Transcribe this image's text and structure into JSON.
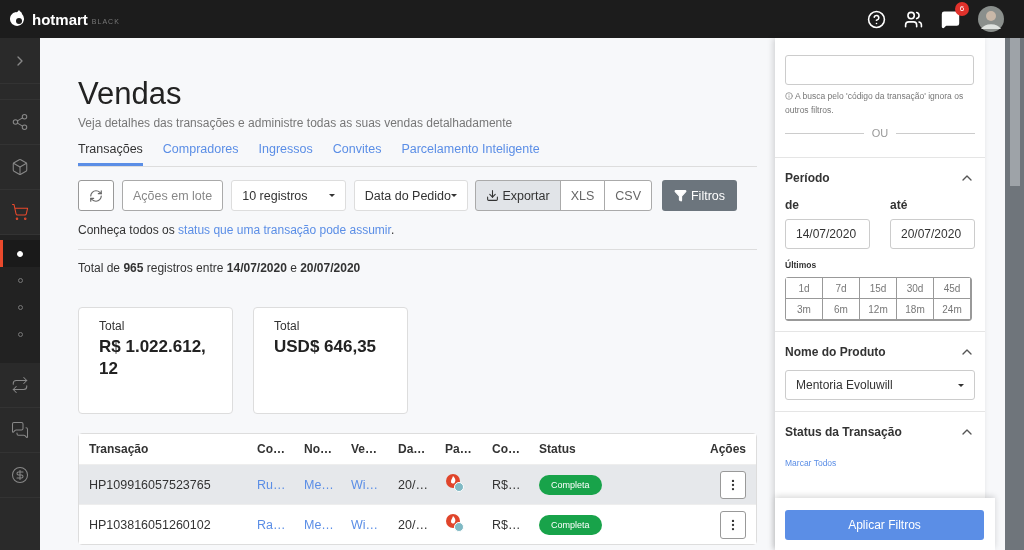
{
  "topbar": {
    "logo": "hotmart",
    "logo_tag": "BLACK",
    "notifications": "6"
  },
  "sidebar": {
    "items": [
      {
        "kind": "network",
        "selected": false
      },
      {
        "kind": "cube",
        "selected": false
      },
      {
        "kind": "cart",
        "selected": true
      },
      {
        "kind": "sub",
        "selected": true
      },
      {
        "kind": "sub",
        "selected": false
      },
      {
        "kind": "sub",
        "selected": false
      },
      {
        "kind": "sub",
        "selected": false
      },
      {
        "kind": "repeat",
        "selected": false
      },
      {
        "kind": "chat",
        "selected": false
      },
      {
        "kind": "dollar",
        "selected": false
      }
    ]
  },
  "page": {
    "title": "Vendas",
    "subtitle": "Veja detalhes das transações e administre todas as suas vendas detalhadamente"
  },
  "tabs": [
    {
      "label": "Transações",
      "selected": true
    },
    {
      "label": "Compradores",
      "selected": false
    },
    {
      "label": "Ingressos",
      "selected": false
    },
    {
      "label": "Convites",
      "selected": false
    },
    {
      "label": "Parcelamento Inteligente",
      "selected": false
    }
  ],
  "toolbar": {
    "batch": "Ações em lote",
    "page_size": "10 registros",
    "date_field": "Data do Pedido",
    "export": "Exportar",
    "formats": [
      "XLS",
      "CSV"
    ],
    "filters": "Filtros"
  },
  "info": {
    "prefix": "Conheça todos os",
    "link": "status que uma transação pode assumir",
    "suffix": "."
  },
  "total_line": "Total de **965** registros entre **14/07/2020** e **20/07/2020**",
  "cards": [
    {
      "label": "Total",
      "value": "R$ 1.022.612,12"
    },
    {
      "label": "Total",
      "value": "USD$ 646,35"
    }
  ],
  "table": {
    "columns": [
      "Transação",
      "Co…",
      "No…",
      "Ve…",
      "Da…",
      "Pa…",
      "Co…",
      "Status",
      "Ações"
    ],
    "rows": [
      {
        "transaction": "HP109916057523765",
        "buyer": "Ru…",
        "product": "Me…",
        "seller": "Wi…",
        "date": "20/…",
        "value": "R$…",
        "status": "Completa",
        "highlighted": true
      },
      {
        "transaction": "HP103816051260102",
        "buyer": "Ra…",
        "product": "Me…",
        "seller": "Wi…",
        "date": "20/…",
        "value": "R$…",
        "status": "Completa",
        "highlighted": false
      }
    ]
  },
  "filters": {
    "code_note": "A busca pelo 'código da transação' ignora os outros filtros.",
    "or": "OU",
    "period": {
      "title": "Período",
      "expanded": true,
      "from_label": "de",
      "to_label": "até",
      "from": "14/07/2020",
      "to": "20/07/2020",
      "recent_label": "Últimos",
      "ranges": [
        "1d",
        "7d",
        "15d",
        "30d",
        "45d",
        "3m",
        "6m",
        "12m",
        "18m",
        "24m"
      ]
    },
    "product": {
      "title": "Nome do Produto",
      "expanded": true,
      "value": "Mentoria Evoluwill"
    },
    "status": {
      "title": "Status da Transação",
      "expanded": true,
      "mark_all": "Marcar Todos"
    },
    "apply": "Aplicar Filtros"
  }
}
